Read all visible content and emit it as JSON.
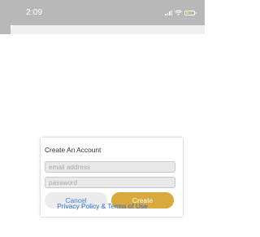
{
  "status_bar": {
    "time": "2:09",
    "signal_icon": "cellular-signal-icon",
    "wifi_icon": "wifi-icon",
    "battery_icon": "battery-icon",
    "battery_level": 0.2,
    "battery_color": "#f2d03a"
  },
  "modal": {
    "title": "Create An Account",
    "email_placeholder": "email address",
    "password_placeholder": "password",
    "cancel_label": "Cancel",
    "create_label": "Create",
    "terms_link": "Privacy Policy & Terms of Use"
  },
  "colors": {
    "accent": "#d8a93c",
    "link": "#2f6fd0",
    "overlay": "#b8b8b8"
  }
}
